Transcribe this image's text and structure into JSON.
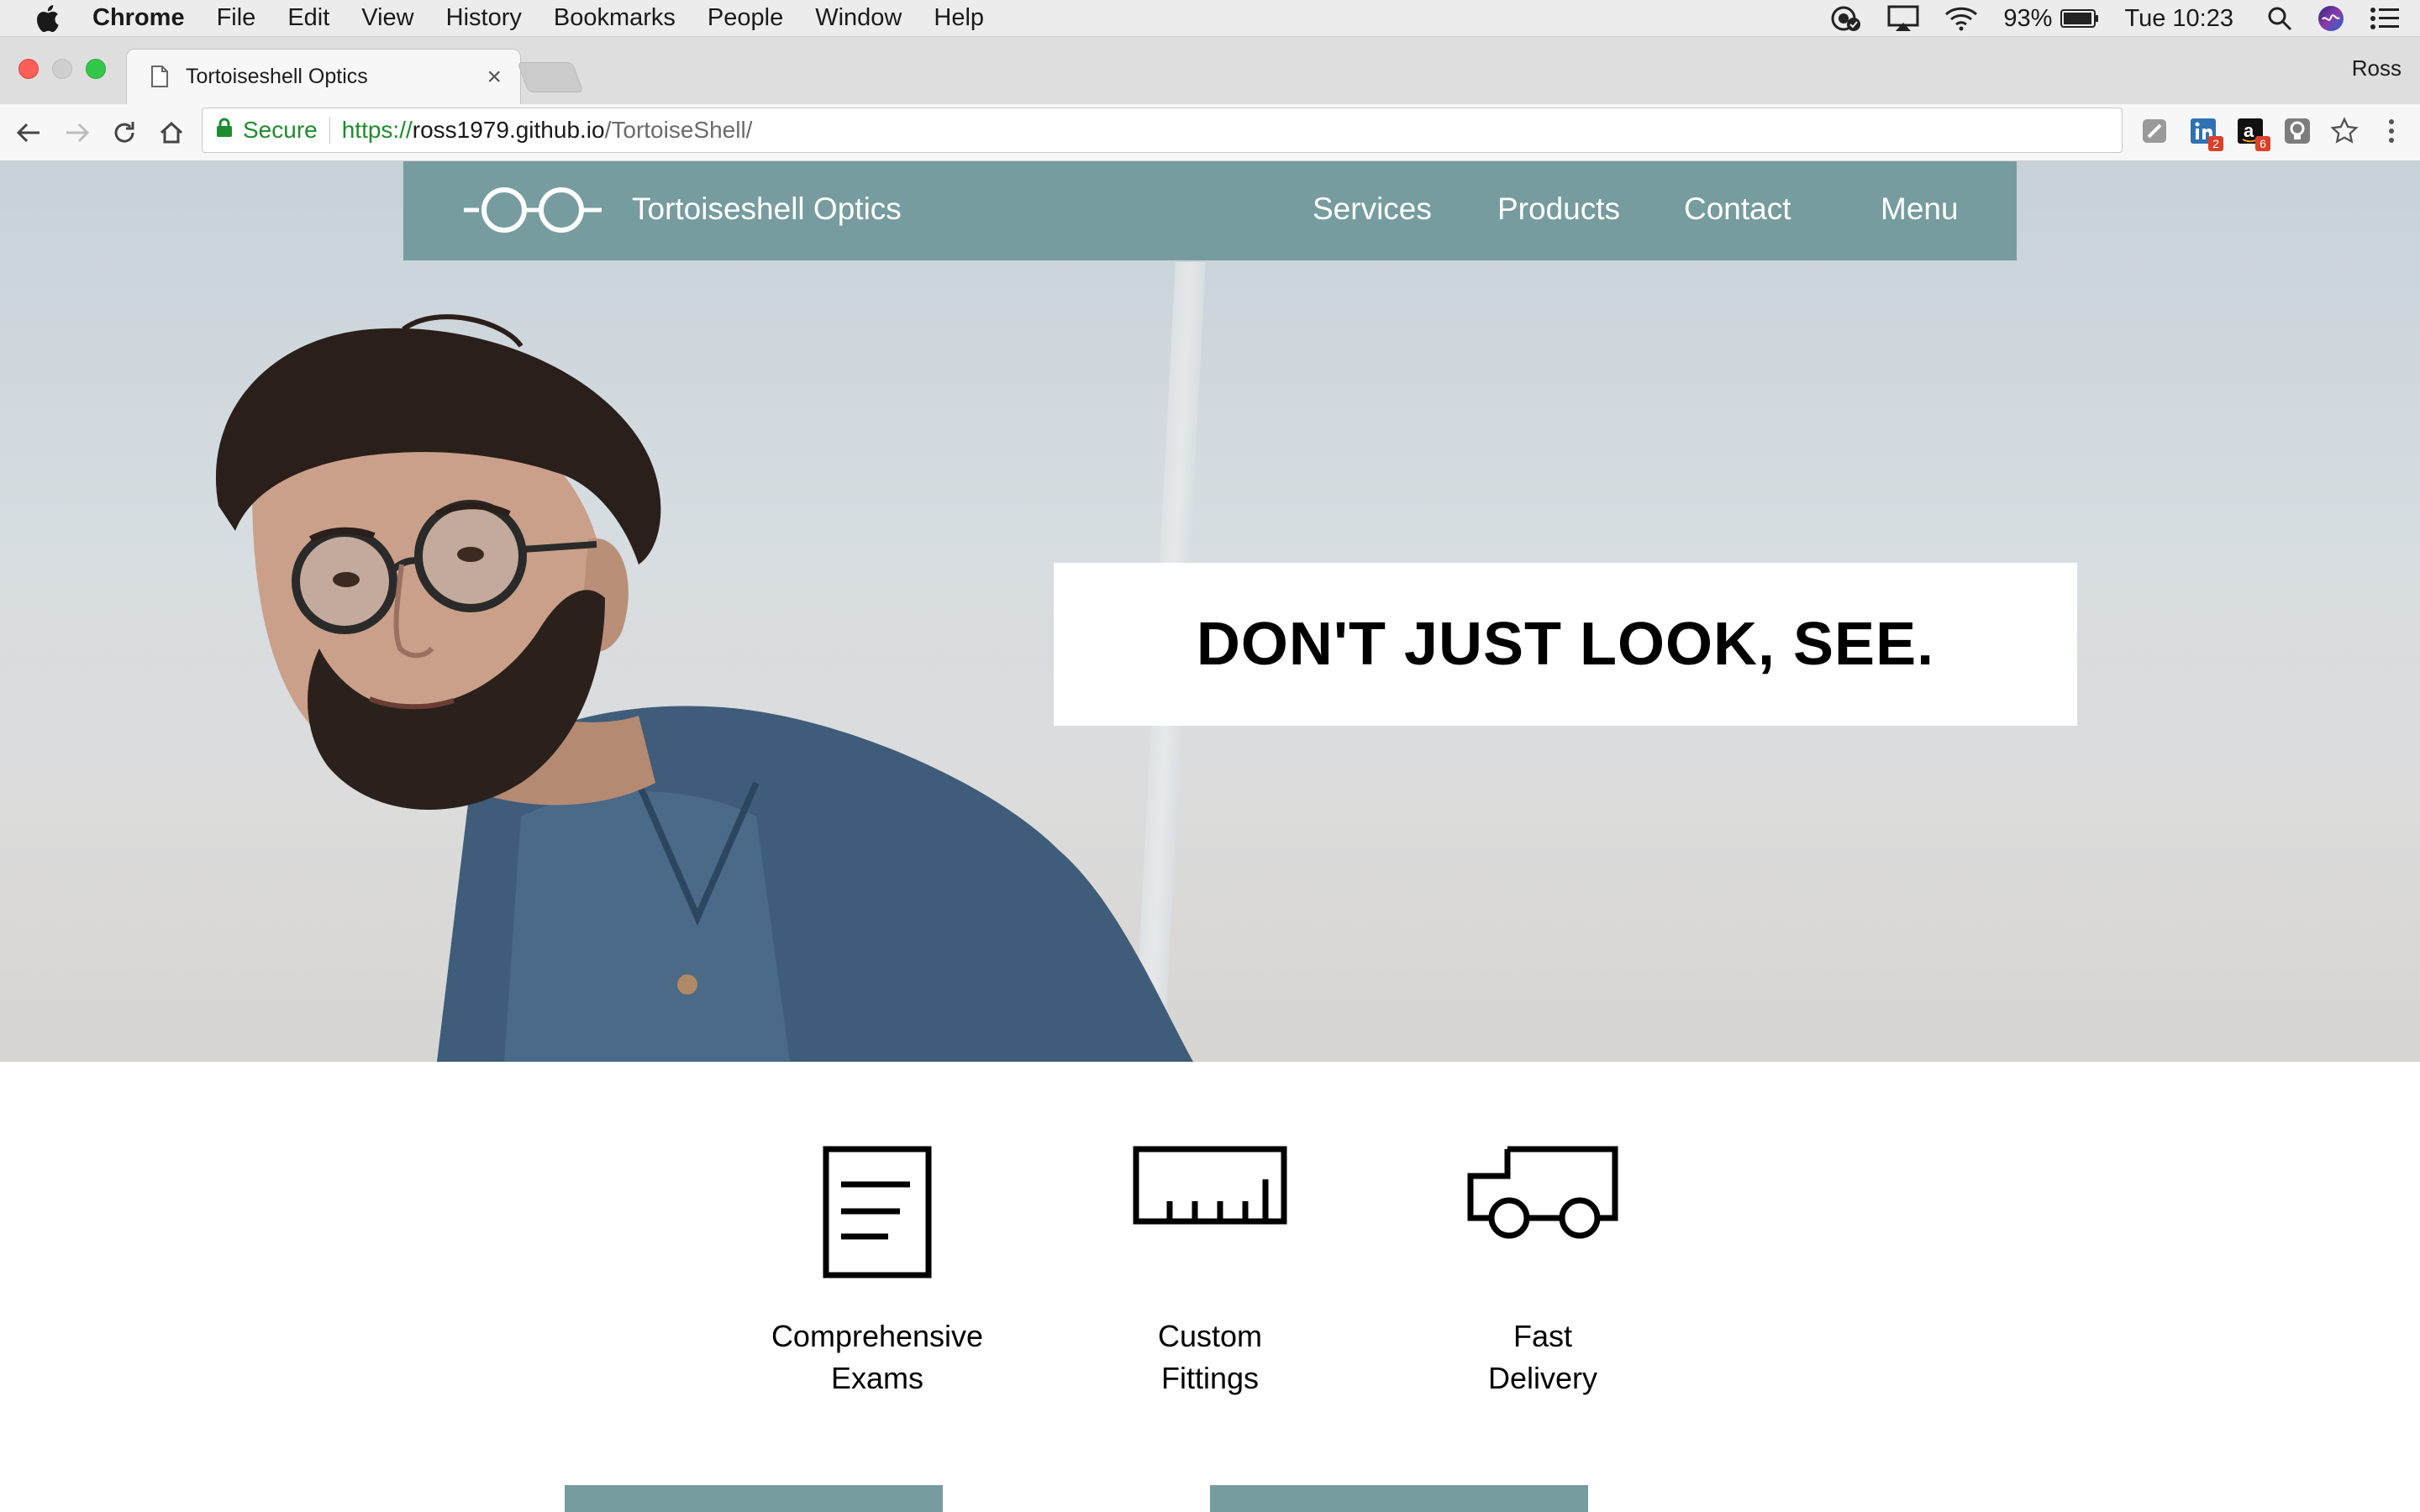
{
  "menubar": {
    "app_name": "Chrome",
    "items": [
      "File",
      "Edit",
      "View",
      "History",
      "Bookmarks",
      "People",
      "Window",
      "Help"
    ],
    "battery": "93%",
    "clock": "Tue 10:23"
  },
  "browser": {
    "tab_title": "Tortoiseshell Optics",
    "tab_close": "×",
    "profile_name": "Ross",
    "secure_label": "Secure",
    "url_scheme": "https://",
    "url_host": "ross1979.github.io",
    "url_path": "/TortoiseShell/",
    "extensions": [
      {
        "name": "extension-icon",
        "badge": ""
      },
      {
        "name": "linkedin-icon",
        "badge": "2"
      },
      {
        "name": "amazon-icon",
        "badge": "6"
      },
      {
        "name": "lightbulb-icon",
        "badge": ""
      }
    ]
  },
  "site": {
    "brand": "Tortoiseshell Optics",
    "nav": [
      "Services",
      "Products",
      "Contact",
      "Menu"
    ],
    "tagline": "DON'T JUST LOOK, SEE.",
    "features": [
      {
        "icon": "document-icon",
        "line1": "Comprehensive",
        "line2": "Exams"
      },
      {
        "icon": "ruler-icon",
        "line1": "Custom",
        "line2": "Fittings"
      },
      {
        "icon": "truck-icon",
        "line1": "Fast",
        "line2": "Delivery"
      }
    ],
    "promos": [
      "",
      ""
    ],
    "colors": {
      "nav_bg": "#779c9f",
      "nav_text": "#ffffff",
      "tagline_bg": "#ffffff"
    }
  }
}
